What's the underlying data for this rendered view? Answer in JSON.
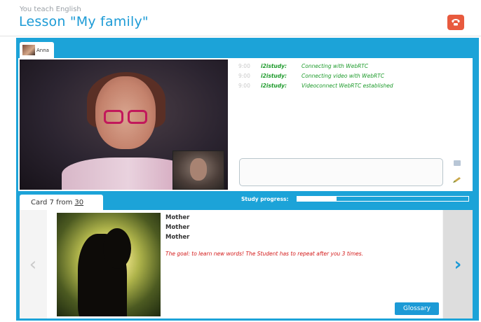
{
  "header": {
    "subtitle": "You teach English",
    "title": "Lesson \"My family\""
  },
  "user_tab": {
    "name": "Anna"
  },
  "chat": {
    "lines": [
      {
        "time": "9:00",
        "user": "i2istudy:",
        "message": "Connecting with WebRTC"
      },
      {
        "time": "9:00",
        "user": "i2istudy:",
        "message": "Connecting video with WebRTC"
      },
      {
        "time": "9:00",
        "user": "i2istudy:",
        "message": "Videoconnect WebRTC established"
      }
    ],
    "input_value": ""
  },
  "card_tab": {
    "prefix": "Card 7 from",
    "total": "30"
  },
  "progress": {
    "label": "Study progress:",
    "fraction": 0.23
  },
  "card": {
    "words": [
      "Mother",
      "Mother",
      "Mother"
    ],
    "goal": "The goal: to learn new words! The Student has to repeat after you 3 times."
  },
  "nav": {
    "prev": "‹",
    "next": "›"
  },
  "buttons": {
    "glossary": "Glossary"
  },
  "colors": {
    "accent": "#1ca3d8",
    "hangup": "#e85a3e",
    "chat_green": "#1c9a2a",
    "goal_red": "#d31919"
  },
  "icons": [
    "hangup-phone-icon",
    "mail-icon",
    "edit-pencil-icon",
    "chevron-left-icon",
    "chevron-right-icon"
  ]
}
